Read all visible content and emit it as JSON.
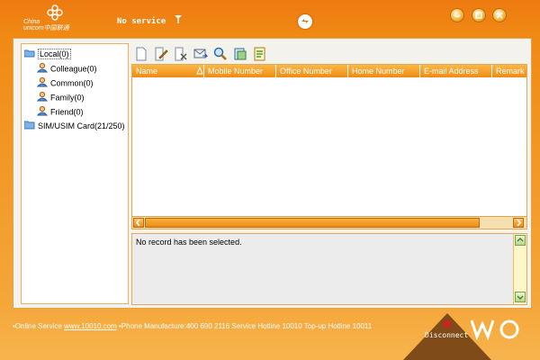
{
  "titlebar": {
    "logo_text_line1": "China",
    "logo_text_line2": "unicom中国联通",
    "status_text": "No service",
    "signal_icon": "antenna-icon",
    "minimize_icon": "minimize-icon",
    "maximize_icon": "maximize-icon",
    "close_icon": "close-icon"
  },
  "tree": {
    "root_local": "Local(0)",
    "groups": [
      "Colleague(0)",
      "Common(0)",
      "Family(0)",
      "Friend(0)"
    ],
    "root_sim": "SIM/USIM Card(21/250)"
  },
  "toolbar": {
    "buttons": [
      "new-contact-icon",
      "edit-icon",
      "delete-icon",
      "send-message-icon",
      "search-icon",
      "copy-to-icon",
      "import-icon"
    ]
  },
  "table": {
    "columns": [
      "Name",
      "Mobile Number",
      "Office Number",
      "Home Number",
      "E-mail Address",
      "Remark"
    ]
  },
  "detail": {
    "message": "No record has been selected."
  },
  "footer": {
    "online_label": "•Online Service",
    "online_link": "www.10010.com",
    "phone_text": "•Phone Manufacture:400 690 2116 Service Hotline 10010 Top-up Hotline 10011"
  },
  "connect": {
    "label": "Disconnect"
  },
  "colors": {
    "brand_orange": "#ef8a14",
    "panel_bg": "#f4f2ec"
  }
}
